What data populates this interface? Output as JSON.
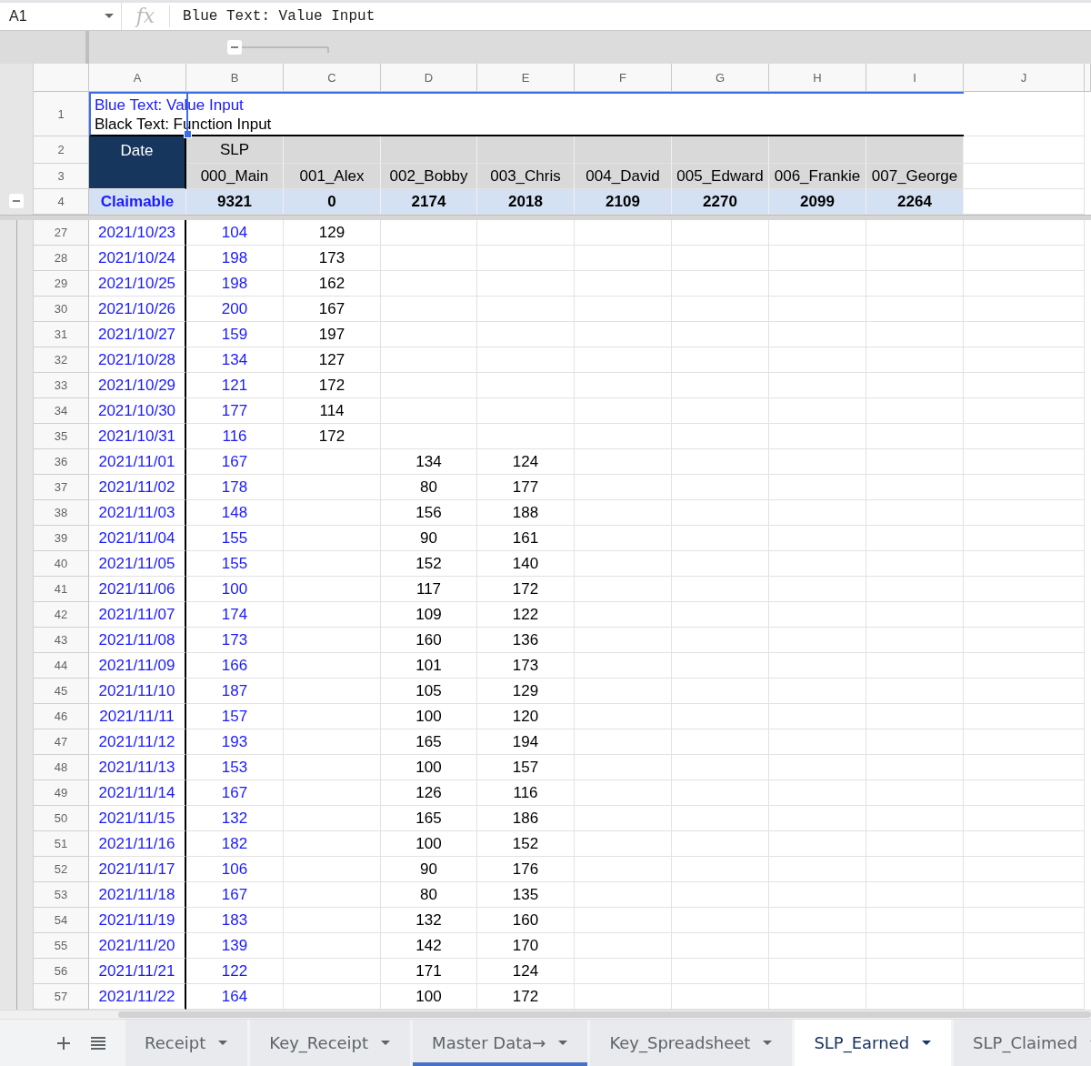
{
  "formula_bar": {
    "cell_ref": "A1",
    "fx": "fx",
    "content": "Blue Text: Value Input"
  },
  "columns": [
    {
      "letter": "A",
      "value_input": true
    },
    {
      "letter": "B",
      "value_input": true
    },
    {
      "letter": "C",
      "value_input": false
    },
    {
      "letter": "D",
      "value_input": false
    },
    {
      "letter": "E",
      "value_input": false
    },
    {
      "letter": "F"
    },
    {
      "letter": "G"
    },
    {
      "letter": "H"
    },
    {
      "letter": "I"
    },
    {
      "letter": "J"
    }
  ],
  "legend": {
    "row": "1",
    "value_note": "Blue Text: Value Input",
    "function_note": "Black Text: Function Input"
  },
  "header": {
    "rows": [
      "2",
      "3"
    ],
    "date_label": "Date",
    "group_label": "SLP",
    "accounts": [
      "000_Main",
      "001_Alex",
      "002_Bobby",
      "003_Chris",
      "004_David",
      "005_Edward",
      "006_Frankie",
      "007_George"
    ]
  },
  "totals": {
    "row": "4",
    "label": "Claimable",
    "values": [
      "9321",
      "0",
      "2174",
      "2018",
      "2109",
      "2270",
      "2099",
      "2264"
    ]
  },
  "rows": [
    {
      "row": "27",
      "cells": {
        "A": "2021/10/23",
        "B": "104",
        "C": "129"
      }
    },
    {
      "row": "28",
      "cells": {
        "A": "2021/10/24",
        "B": "198",
        "C": "173"
      }
    },
    {
      "row": "29",
      "cells": {
        "A": "2021/10/25",
        "B": "198",
        "C": "162"
      }
    },
    {
      "row": "30",
      "cells": {
        "A": "2021/10/26",
        "B": "200",
        "C": "167"
      }
    },
    {
      "row": "31",
      "cells": {
        "A": "2021/10/27",
        "B": "159",
        "C": "197"
      }
    },
    {
      "row": "32",
      "cells": {
        "A": "2021/10/28",
        "B": "134",
        "C": "127"
      }
    },
    {
      "row": "33",
      "cells": {
        "A": "2021/10/29",
        "B": "121",
        "C": "172"
      }
    },
    {
      "row": "34",
      "cells": {
        "A": "2021/10/30",
        "B": "177",
        "C": "114"
      }
    },
    {
      "row": "35",
      "cells": {
        "A": "2021/10/31",
        "B": "116",
        "C": "172"
      }
    },
    {
      "row": "36",
      "cells": {
        "A": "2021/11/01",
        "B": "167",
        "D": "134",
        "E": "124"
      }
    },
    {
      "row": "37",
      "cells": {
        "A": "2021/11/02",
        "B": "178",
        "D": "80",
        "E": "177"
      }
    },
    {
      "row": "38",
      "cells": {
        "A": "2021/11/03",
        "B": "148",
        "D": "156",
        "E": "188"
      }
    },
    {
      "row": "39",
      "cells": {
        "A": "2021/11/04",
        "B": "155",
        "D": "90",
        "E": "161"
      }
    },
    {
      "row": "40",
      "cells": {
        "A": "2021/11/05",
        "B": "155",
        "D": "152",
        "E": "140"
      }
    },
    {
      "row": "41",
      "cells": {
        "A": "2021/11/06",
        "B": "100",
        "D": "117",
        "E": "172"
      }
    },
    {
      "row": "42",
      "cells": {
        "A": "2021/11/07",
        "B": "174",
        "D": "109",
        "E": "122"
      }
    },
    {
      "row": "43",
      "cells": {
        "A": "2021/11/08",
        "B": "173",
        "D": "160",
        "E": "136"
      }
    },
    {
      "row": "44",
      "cells": {
        "A": "2021/11/09",
        "B": "166",
        "D": "101",
        "E": "173"
      }
    },
    {
      "row": "45",
      "cells": {
        "A": "2021/11/10",
        "B": "187",
        "D": "105",
        "E": "129"
      }
    },
    {
      "row": "46",
      "cells": {
        "A": "2021/11/11",
        "B": "157",
        "D": "100",
        "E": "120"
      }
    },
    {
      "row": "47",
      "cells": {
        "A": "2021/11/12",
        "B": "193",
        "D": "165",
        "E": "194"
      }
    },
    {
      "row": "48",
      "cells": {
        "A": "2021/11/13",
        "B": "153",
        "D": "100",
        "E": "157"
      }
    },
    {
      "row": "49",
      "cells": {
        "A": "2021/11/14",
        "B": "167",
        "D": "126",
        "E": "116"
      }
    },
    {
      "row": "50",
      "cells": {
        "A": "2021/11/15",
        "B": "132",
        "D": "165",
        "E": "186"
      }
    },
    {
      "row": "51",
      "cells": {
        "A": "2021/11/16",
        "B": "182",
        "D": "100",
        "E": "152"
      }
    },
    {
      "row": "52",
      "cells": {
        "A": "2021/11/17",
        "B": "106",
        "D": "90",
        "E": "176"
      }
    },
    {
      "row": "53",
      "cells": {
        "A": "2021/11/18",
        "B": "167",
        "D": "80",
        "E": "135"
      }
    },
    {
      "row": "54",
      "cells": {
        "A": "2021/11/19",
        "B": "183",
        "D": "132",
        "E": "160"
      }
    },
    {
      "row": "55",
      "cells": {
        "A": "2021/11/20",
        "B": "139",
        "D": "142",
        "E": "170"
      }
    },
    {
      "row": "56",
      "cells": {
        "A": "2021/11/21",
        "B": "122",
        "D": "171",
        "E": "124"
      }
    },
    {
      "row": "57",
      "cells": {
        "A": "2021/11/22",
        "B": "164",
        "D": "100",
        "E": "172"
      }
    }
  ],
  "tabs": [
    {
      "label": "Receipt",
      "selected": false
    },
    {
      "label": "Key_Receipt",
      "selected": false
    },
    {
      "label": "Master Data→",
      "selected": false,
      "color": "#4472c4"
    },
    {
      "label": "Key_Spreadsheet",
      "selected": false
    },
    {
      "label": "SLP_Earned",
      "selected": true
    },
    {
      "label": "SLP_Claimed",
      "selected": false
    }
  ]
}
